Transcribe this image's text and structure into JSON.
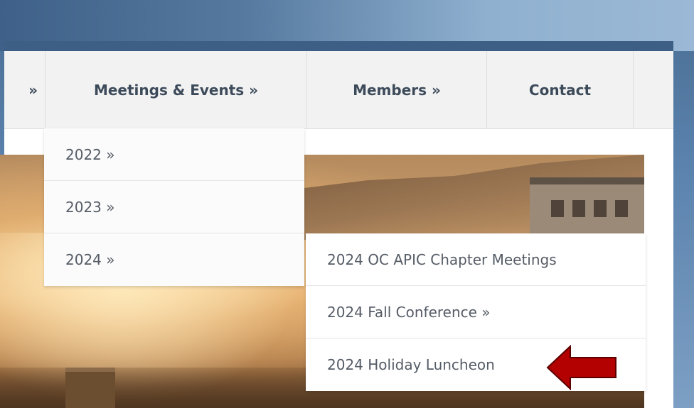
{
  "nav": {
    "items": [
      {
        "label": "»"
      },
      {
        "label": "Meetings & Events  »"
      },
      {
        "label": "Members  »"
      },
      {
        "label": "Contact"
      },
      {
        "label": ""
      }
    ]
  },
  "submenu_years": {
    "items": [
      {
        "label": "2022  »"
      },
      {
        "label": "2023  »"
      },
      {
        "label": "2024  »"
      }
    ]
  },
  "submenu_2024": {
    "items": [
      {
        "label": "2024 OC APIC Chapter Meetings"
      },
      {
        "label": "2024 Fall Conference  »"
      },
      {
        "label": "2024 Holiday Luncheon"
      }
    ]
  },
  "annotation": {
    "arrow_color": "#b30000",
    "arrow_icon": "left-arrow-icon"
  },
  "colors": {
    "frame_blue": "#3d5f86",
    "nav_bg": "#f2f2f2",
    "nav_text": "#3c4a5a",
    "menu_text": "#555c66"
  }
}
